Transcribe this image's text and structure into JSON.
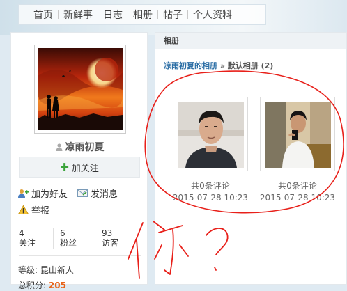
{
  "nav": {
    "items": [
      "首页",
      "新鲜事",
      "日志",
      "相册",
      "帖子",
      "个人资料"
    ]
  },
  "profile": {
    "username": "凉雨初夏",
    "follow_label": "加关注",
    "add_friend_label": "加为好友",
    "message_label": "发消息",
    "report_label": "举报",
    "stats": [
      {
        "value": "4",
        "label": "关注"
      },
      {
        "value": "6",
        "label": "粉丝"
      },
      {
        "value": "93",
        "label": "访客"
      }
    ],
    "level_label": "等级:",
    "level_value": "昆山新人",
    "points_label": "总积分:",
    "points_value": "205"
  },
  "album": {
    "panel_title": "相册",
    "crumb_owner": "凉雨初夏的相册",
    "crumb_sep": "»",
    "crumb_current": "默认相册 (2)",
    "photos": [
      {
        "comments": "共0条评论",
        "date": "2015-07-28 10:23"
      },
      {
        "comments": "共0条评论",
        "date": "2015-07-28 10:23"
      }
    ]
  },
  "annotation": {
    "handwriting": "你?",
    "ink_color": "#e8201a"
  },
  "colors": {
    "link_blue": "#2b6ea5",
    "points_orange": "#e8641b",
    "follow_green": "#3aa33a"
  }
}
